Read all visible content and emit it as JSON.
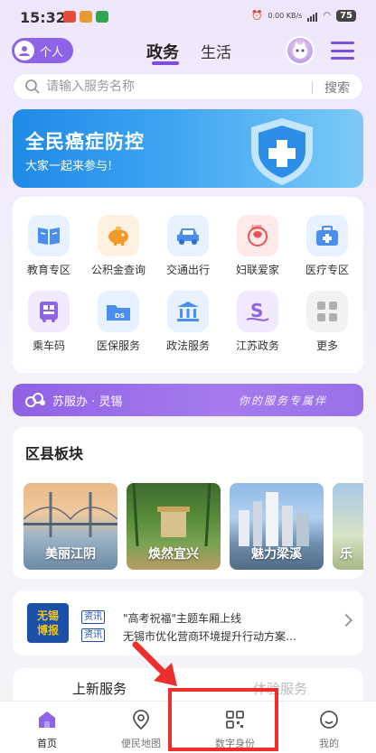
{
  "status_bar": {
    "time": "15:32",
    "network_speed": "0.00 KB/s",
    "battery": "75"
  },
  "header": {
    "personal_label": "个人",
    "tabs": [
      {
        "label": "政务",
        "active": true
      },
      {
        "label": "生活",
        "active": false
      }
    ]
  },
  "search": {
    "placeholder": "请输入服务名称",
    "button_label": "搜索"
  },
  "banner": {
    "title": "全民癌症防控",
    "subtitle": "大家一起来参与!"
  },
  "services": {
    "items": [
      {
        "label": "教育专区",
        "icon": "book-icon",
        "color": "#4a8ef0"
      },
      {
        "label": "公积金查询",
        "icon": "piggy-bank-icon",
        "color": "#f39a2f"
      },
      {
        "label": "交通出行",
        "icon": "car-icon",
        "color": "#4a8ef0"
      },
      {
        "label": "妇联爱家",
        "icon": "womens-federation-icon",
        "color": "#e8534f"
      },
      {
        "label": "医疗专区",
        "icon": "medical-kit-icon",
        "color": "#4a8ef0"
      },
      {
        "label": "乘车码",
        "icon": "bus-code-icon",
        "color": "#8f62e6"
      },
      {
        "label": "医保服务",
        "icon": "medical-insurance-card-icon",
        "color": "#4a8ef0"
      },
      {
        "label": "政法服务",
        "icon": "courthouse-icon",
        "color": "#4a8ef0"
      },
      {
        "label": "江苏政务",
        "icon": "jiangsu-gov-icon",
        "color": "#8f62e6"
      },
      {
        "label": "更多",
        "icon": "more-grid-icon",
        "color": "#b0b0b0"
      }
    ]
  },
  "su_banner": {
    "label": "苏服办 · 灵锡",
    "slogan": "你的服务专属伴"
  },
  "district": {
    "title": "区县板块",
    "items": [
      {
        "label": "美丽江阴"
      },
      {
        "label": "焕然宜兴"
      },
      {
        "label": "魅力梁溪"
      },
      {
        "label": "乐"
      }
    ]
  },
  "news": {
    "logo_line1": "无锡",
    "logo_line2": "博报",
    "items": [
      {
        "tag": "资讯",
        "text": "\"高考祝福\"主题车厢上线"
      },
      {
        "tag": "资讯",
        "text": "无锡市优化营商环境提升行动方案…"
      }
    ]
  },
  "sub_tabs": {
    "new_label": "上新服务",
    "hot_label": "体验服务"
  },
  "bottom_nav": {
    "items": [
      {
        "label": "首页",
        "active": true
      },
      {
        "label": "便民地图",
        "active": false
      },
      {
        "label": "数字身份",
        "active": false
      },
      {
        "label": "我的",
        "active": false
      }
    ]
  },
  "colors": {
    "accent": "#7b4fe0",
    "annotation": "#ee2d2d"
  }
}
